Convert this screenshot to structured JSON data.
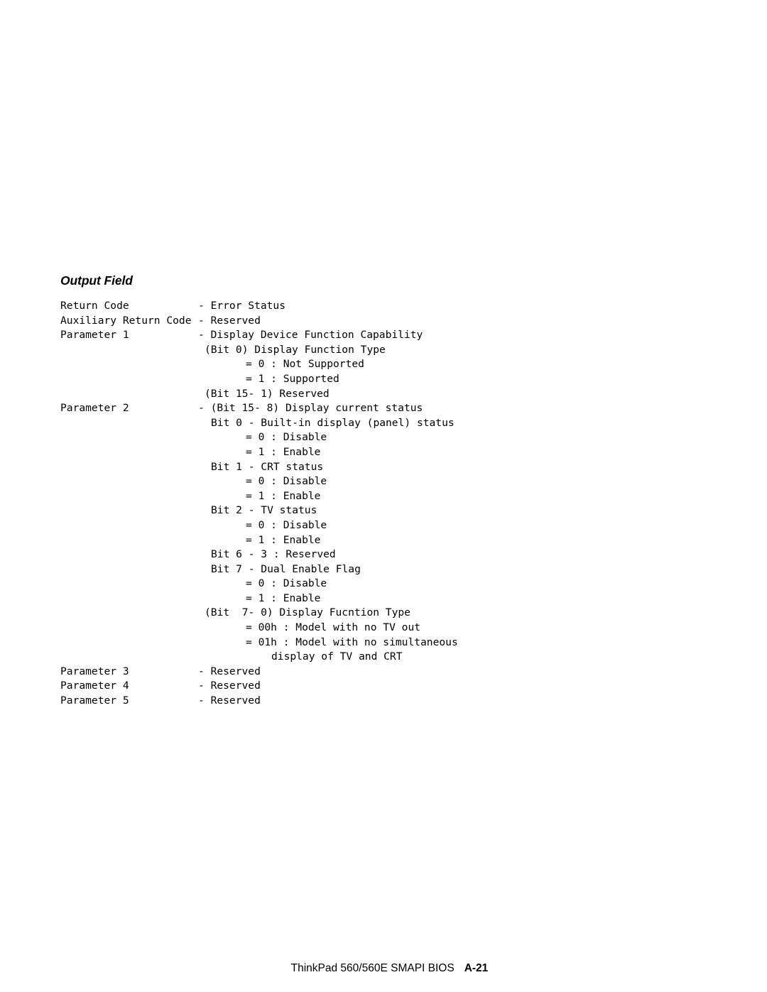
{
  "page": {
    "background_color": "#ffffff",
    "text_color": "#000000"
  },
  "section": {
    "heading": "Output Field"
  },
  "field_listing": {
    "lines": [
      {
        "label": "Return Code",
        "indent": "dash",
        "value": "- Error Status"
      },
      {
        "label": "Auxiliary Return Code",
        "indent": "dash",
        "value": "- Reserved"
      },
      {
        "label": "Parameter 1",
        "indent": "dash",
        "value": "- Display Device Function Capability"
      },
      {
        "label": "",
        "indent": "paren",
        "value": "(Bit 0) Display Function Type"
      },
      {
        "label": "",
        "indent": "eq",
        "value": "= 0 : Not Supported"
      },
      {
        "label": "",
        "indent": "eq",
        "value": "= 1 : Supported"
      },
      {
        "label": "",
        "indent": "paren",
        "value": "(Bit 15- 1) Reserved"
      },
      {
        "label": "Parameter 2",
        "indent": "dash",
        "value": "- (Bit 15- 8) Display current status"
      },
      {
        "label": "",
        "indent": "bit",
        "value": "Bit 0 - Built-in display (panel) status"
      },
      {
        "label": "",
        "indent": "eq",
        "value": "= 0 : Disable"
      },
      {
        "label": "",
        "indent": "eq",
        "value": "= 1 : Enable"
      },
      {
        "label": "",
        "indent": "bit",
        "value": "Bit 1 - CRT status"
      },
      {
        "label": "",
        "indent": "eq",
        "value": "= 0 : Disable"
      },
      {
        "label": "",
        "indent": "eq",
        "value": "= 1 : Enable"
      },
      {
        "label": "",
        "indent": "bit",
        "value": "Bit 2 - TV status"
      },
      {
        "label": "",
        "indent": "eq",
        "value": "= 0 : Disable"
      },
      {
        "label": "",
        "indent": "eq",
        "value": "= 1 : Enable"
      },
      {
        "label": "",
        "indent": "bit",
        "value": "Bit 6 - 3 : Reserved"
      },
      {
        "label": "",
        "indent": "bit",
        "value": "Bit 7 - Dual Enable Flag"
      },
      {
        "label": "",
        "indent": "eq",
        "value": "= 0 : Disable"
      },
      {
        "label": "",
        "indent": "eq",
        "value": "= 1 : Enable"
      },
      {
        "label": "",
        "indent": "paren",
        "value": "(Bit  7- 0) Display Fucntion Type"
      },
      {
        "label": "",
        "indent": "eq",
        "value": "= 00h : Model with no TV out"
      },
      {
        "label": "",
        "indent": "eq",
        "value": "= 01h : Model with no simultaneous"
      },
      {
        "label": "",
        "indent": "cont",
        "value": "display of TV and CRT"
      },
      {
        "label": "Parameter 3",
        "indent": "dash",
        "value": "- Reserved"
      },
      {
        "label": "Parameter 4",
        "indent": "dash",
        "value": "- Reserved"
      },
      {
        "label": "Parameter 5",
        "indent": "dash",
        "value": "- Reserved"
      }
    ]
  },
  "footer": {
    "doc_title": "ThinkPad 560/560E SMAPI BIOS",
    "page_number": "A-21"
  }
}
